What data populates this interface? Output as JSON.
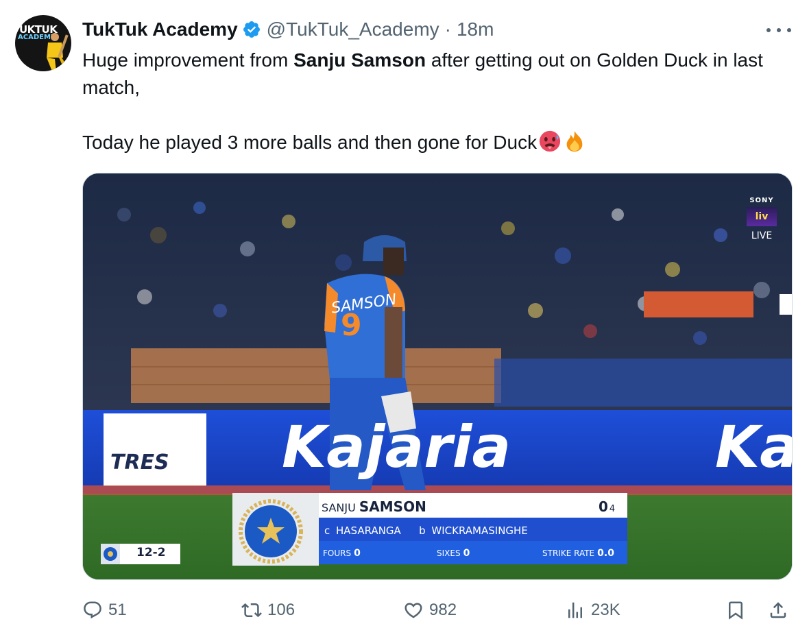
{
  "tweet": {
    "avatar_text_top": "UKTUK",
    "avatar_text_bottom": "ACADEMY",
    "author_name": "TukTuk Academy",
    "handle": "@TukTuk_Academy",
    "separator": "·",
    "time": "18m",
    "verified_icon": "verified-badge-icon",
    "more_icon": "more-options-icon",
    "text_line1_prefix": "Huge improvement from ",
    "text_line1_bold": "Sanju Samson",
    "text_line1_suffix": " after getting out on Golden Duck in last match,",
    "text_line2": "Today he played 3 more balls and then gone for Duck",
    "emojis": [
      "hot-face-emoji",
      "fire-emoji"
    ]
  },
  "media": {
    "broadcaster_top": "SONY",
    "broadcaster_logo": "liv",
    "broadcaster_status": "LIVE",
    "jersey_name": "SAMSON",
    "jersey_number": "9",
    "board_left": "TRES",
    "board_main": "Kajaria",
    "board_right": "Ka",
    "scorecard": {
      "first_name": "SANJU",
      "last_name": "SAMSON",
      "runs": "0",
      "balls": "4",
      "dismissal_caught": "c HASARANGA",
      "dismissal_bowler": "b WICKRAMASINGHE",
      "fours_label": "FOURS",
      "fours_value": "0",
      "sixes_label": "SIXES",
      "sixes_value": "0",
      "strike_rate_label": "STRIKE RATE",
      "strike_rate_value": "0.0"
    },
    "team_score": "12-2"
  },
  "actions": {
    "replies": "51",
    "reposts": "106",
    "likes": "982",
    "views": "23K"
  },
  "colors": {
    "text_primary": "#0f1419",
    "text_secondary": "#536471",
    "verified": "#1d9bf0",
    "border": "#cfd9de"
  }
}
